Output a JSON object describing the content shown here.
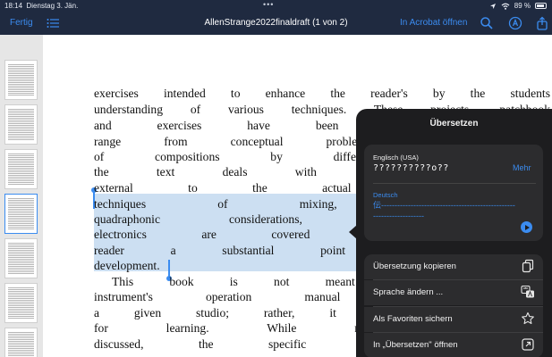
{
  "status": {
    "time": "18:14",
    "date": "Dienstag 3. Jän.",
    "battery": "89 %"
  },
  "nav": {
    "done_label": "Fertig",
    "title": "AllenStrange2022finaldraft (1 von 2)",
    "open_in_acrobat": "In Acrobat öffnen"
  },
  "document": {
    "lines": [
      "exercises intended to enhance the reader's by the students",
      "understanding of various techniques. These projects, patchbook",
      "and exercises have been suggested by col",
      "range from conceptual problem solving to th",
      "of compositions by different composers. The",
      "the text deals with techniques and devi",
      "external to the actual performance instru",
      "techniques of mixing, tape recording,",
      "quadraphonic considerations, as well as",
      "electronics are covered in sufficient deta",
      "reader a substantial point of departure fo",
      "development.",
      "This book is not meant to be a subst",
      "instrument's operation manual or a general",
      "a given studio; rather, it is a basic organiz",
      "for learning. While many detailed tec",
      "discussed, the specific patching format s"
    ]
  },
  "translate": {
    "title": "Übersetzen",
    "source_language": "Englisch (USA)",
    "source_text": "??????????o??",
    "more_label": "Mehr",
    "target_language": "Deutsch",
    "target_text": "伝---------------------------------------------------------------------",
    "actions": [
      {
        "label": "Übersetzung kopieren",
        "icon": "copy-icon"
      },
      {
        "label": "Sprache ändern ...",
        "icon": "language-icon"
      },
      {
        "label": "Als Favoriten sichern",
        "icon": "star-icon"
      },
      {
        "label": "In „Übersetzen\" öffnen",
        "icon": "open-external-icon"
      }
    ]
  },
  "colors": {
    "accent": "#3b8cf0",
    "bar": "#1f2a40",
    "popover": "#1d1d1f"
  }
}
